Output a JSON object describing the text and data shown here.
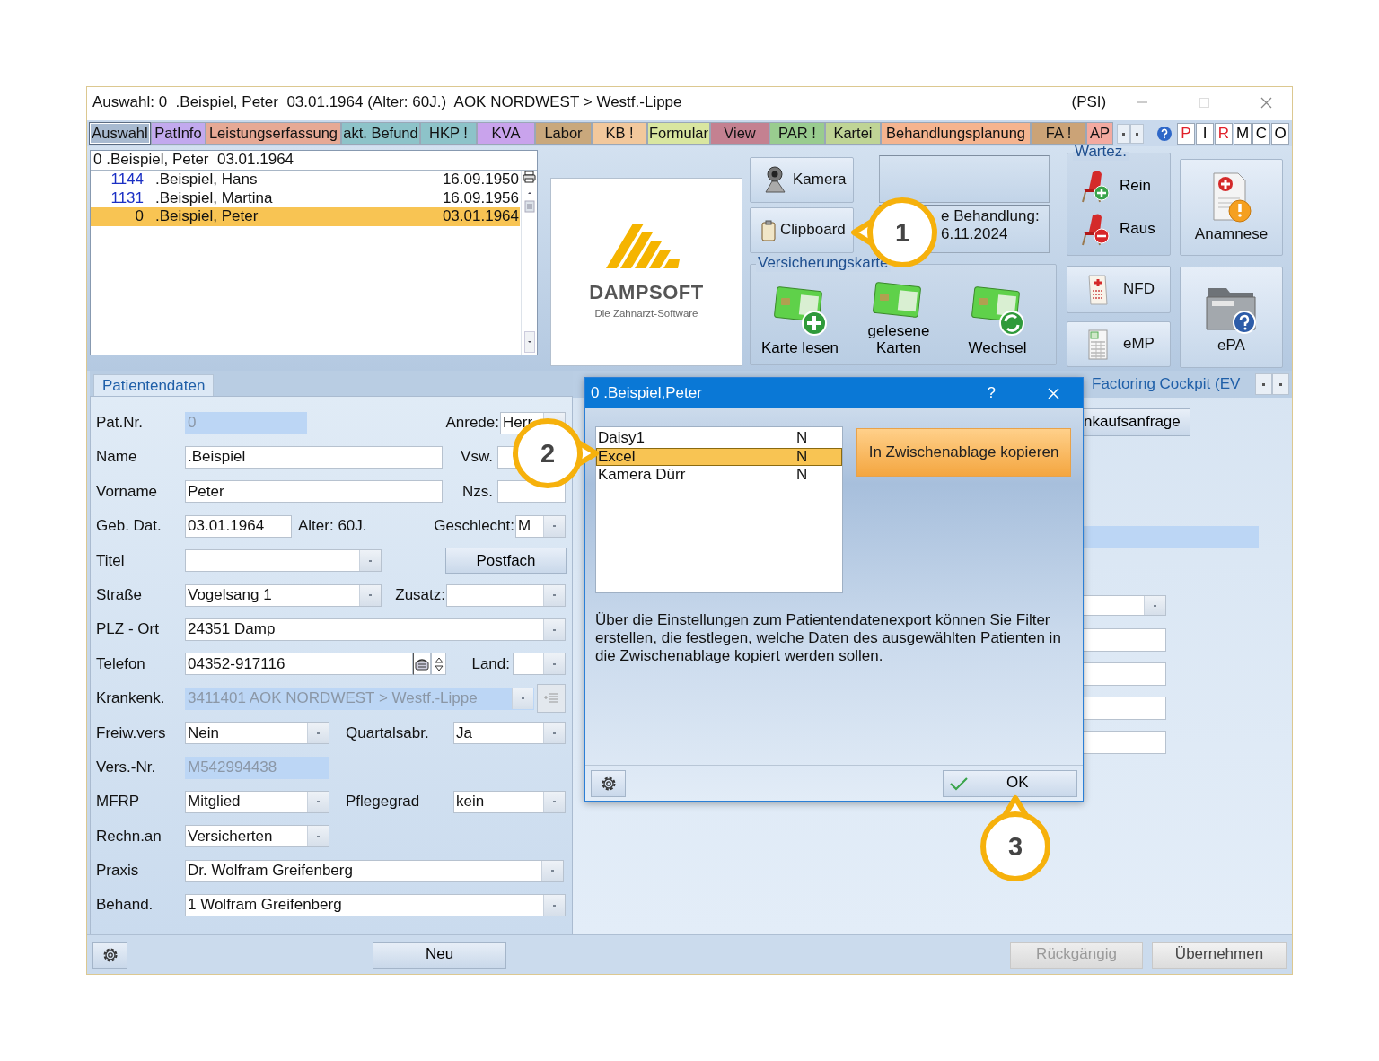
{
  "window": {
    "title": "Auswahl: 0  .Beispiel, Peter  03.01.1964 (Alter: 60J.)  AOK NORDWEST > Westf.-Lippe",
    "tag": "(PSI)"
  },
  "tabs": [
    {
      "label": "Auswahl",
      "color": "#a8bad0",
      "selected": true
    },
    {
      "label": "PatInfo",
      "color": "#c2a9ee",
      "selected": false
    },
    {
      "label": "Leistungserfassung",
      "color": "#e6a995",
      "selected": false
    },
    {
      "label": "akt. Befund",
      "color": "#8dc3c9",
      "selected": false
    },
    {
      "label": "HKP !",
      "color": "#8dc3c9",
      "selected": false
    },
    {
      "label": "KVA",
      "color": "#c9a3ec",
      "selected": false
    },
    {
      "label": "Labor",
      "color": "#c9a87c",
      "selected": false
    },
    {
      "label": "KB !",
      "color": "#f2c89c",
      "selected": false
    },
    {
      "label": "Formular",
      "color": "#d9e6a0",
      "selected": false
    },
    {
      "label": "View",
      "color": "#c48191",
      "selected": false
    },
    {
      "label": "PAR !",
      "color": "#99cc8f",
      "selected": false
    },
    {
      "label": "Kartei",
      "color": "#bfd495",
      "selected": false
    },
    {
      "label": "Behandlungsplanung",
      "color": "#f5b48f",
      "selected": false
    },
    {
      "label": "FA !",
      "color": "#cba377",
      "selected": false
    },
    {
      "label": "AP",
      "color": "#f3aaa0",
      "selected": false
    }
  ],
  "letters": [
    {
      "label": "P",
      "flagged": true
    },
    {
      "label": "I",
      "flagged": false
    },
    {
      "label": "R",
      "flagged": true
    },
    {
      "label": "M",
      "flagged": false
    },
    {
      "label": "C",
      "flagged": false
    },
    {
      "label": "O",
      "flagged": false
    }
  ],
  "patient_search": {
    "value": "0 .Beispiel, Peter  03.01.1964"
  },
  "patients": [
    {
      "number": "1144",
      "name": ".Beispiel, Hans",
      "birth_date": "16.09.1950",
      "selected": false
    },
    {
      "number": "1131",
      "name": ".Beispiel, Martina",
      "birth_date": "16.09.1956",
      "selected": false
    },
    {
      "number": "0",
      "name": ".Beispiel, Peter",
      "birth_date": "03.01.1964",
      "selected": true
    }
  ],
  "logo": {
    "name": "DAMPSOFT",
    "tagline": "Die Zahnarzt-Software"
  },
  "tool_buttons": [
    {
      "kind": "camera",
      "label": "Kamera"
    },
    {
      "kind": "clipboard",
      "label": "Clipboard"
    }
  ],
  "last_treatment": {
    "label": "e Behandlung:",
    "date": "6.11.2024"
  },
  "insurance_card": {
    "title": "Versicherungskarte",
    "buttons": [
      {
        "kind": "read",
        "label": "Karte lesen"
      },
      {
        "kind": "list",
        "label": "gelesene Karten"
      },
      {
        "kind": "swap",
        "label": "Wechsel"
      }
    ]
  },
  "waiting_room": {
    "title": "Wartez.",
    "buttons": [
      {
        "kind": "in",
        "label": "Rein"
      },
      {
        "kind": "out",
        "label": "Raus"
      }
    ]
  },
  "side_buttons": [
    {
      "kind": "anamnese",
      "label": "Anamnese"
    },
    {
      "kind": "nfd",
      "label": "NFD"
    },
    {
      "kind": "emp",
      "label": "eMP"
    },
    {
      "kind": "epa",
      "label": "ePA"
    }
  ],
  "patient_tab": {
    "label": "Patientendaten",
    "selected": true
  },
  "form": {
    "rows": [
      {
        "items": [
          {
            "kind": "label",
            "text": "Pat.Nr."
          },
          {
            "kind": "readonly",
            "value": "0"
          },
          {
            "kind": "label",
            "text": "Anrede:"
          },
          {
            "kind": "select",
            "value": "Herr"
          }
        ]
      },
      {
        "items": [
          {
            "kind": "label",
            "text": "Name"
          },
          {
            "kind": "input",
            "value": ".Beispiel"
          },
          {
            "kind": "label",
            "text": "Vsw."
          },
          {
            "kind": "input"
          }
        ]
      },
      {
        "items": [
          {
            "kind": "label",
            "text": "Vorname"
          },
          {
            "kind": "input",
            "value": "Peter"
          },
          {
            "kind": "label",
            "text": "Nzs."
          },
          {
            "kind": "input"
          }
        ]
      },
      {
        "items": [
          {
            "kind": "label",
            "text": "Geb. Dat."
          },
          {
            "kind": "input",
            "value": "03.01.1964"
          },
          {
            "kind": "label",
            "text": "Alter: 60J."
          },
          {
            "kind": "label",
            "text": "Geschlecht:"
          },
          {
            "kind": "select",
            "value": "M"
          }
        ]
      },
      {
        "items": [
          {
            "kind": "label",
            "text": "Titel"
          },
          {
            "kind": "select"
          },
          {
            "kind": "button",
            "text": "Postfach"
          }
        ]
      },
      {
        "items": [
          {
            "kind": "label",
            "text": "Straße"
          },
          {
            "kind": "select",
            "value": "Vogelsang 1"
          },
          {
            "kind": "label",
            "text": "Zusatz:"
          },
          {
            "kind": "select"
          }
        ]
      },
      {
        "items": [
          {
            "kind": "label",
            "text": "PLZ - Ort"
          },
          {
            "kind": "select",
            "value": "24351 Damp"
          }
        ]
      },
      {
        "items": [
          {
            "kind": "label",
            "text": "Telefon"
          },
          {
            "kind": "phone",
            "value": "04352-917116"
          },
          {
            "kind": "label",
            "text": "Land:"
          },
          {
            "kind": "select"
          }
        ]
      },
      {
        "items": [
          {
            "kind": "label",
            "text": "Krankenk."
          },
          {
            "kind": "readonly_select",
            "value": "3411401 AOK NORDWEST > Westf.-Lippe"
          },
          {
            "kind": "list_button"
          }
        ]
      },
      {
        "items": [
          {
            "kind": "label",
            "text": "Freiw.vers"
          },
          {
            "kind": "select",
            "value": "Nein"
          },
          {
            "kind": "label",
            "text": "Quartalsabr."
          },
          {
            "kind": "select",
            "value": "Ja"
          }
        ]
      },
      {
        "items": [
          {
            "kind": "label",
            "text": "Vers.-Nr."
          },
          {
            "kind": "readonly",
            "value": "M542994438"
          }
        ]
      },
      {
        "items": [
          {
            "kind": "label",
            "text": "MFRP"
          },
          {
            "kind": "select",
            "value": "Mitglied"
          },
          {
            "kind": "label",
            "text": "Pflegegrad"
          },
          {
            "kind": "select",
            "value": "kein"
          }
        ]
      },
      {
        "items": [
          {
            "kind": "label",
            "text": "Rechn.an"
          },
          {
            "kind": "select",
            "value": "Versicherten"
          }
        ]
      },
      {
        "items": [
          {
            "kind": "label",
            "text": "Praxis"
          },
          {
            "kind": "select",
            "value": "Dr. Wolfram Greifenberg"
          }
        ]
      },
      {
        "items": [
          {
            "kind": "label",
            "text": "Behand."
          },
          {
            "kind": "select",
            "value": "1 Wolfram Greifenberg"
          }
        ]
      }
    ]
  },
  "right_panel": {
    "tab": "Factoring Cockpit (EV",
    "button": "nkaufsanfrage"
  },
  "footer": {
    "new": "Neu",
    "undo": {
      "label": "Rückgängig",
      "disabled": true
    },
    "apply": {
      "label": "Übernehmen",
      "disabled": false
    }
  },
  "dialog": {
    "title": "0 .Beispiel,Peter",
    "help": "?",
    "exports": [
      {
        "name": "Daisy1",
        "flag": "N",
        "selected": false
      },
      {
        "name": "Excel",
        "flag": "N",
        "selected": true
      },
      {
        "name": "Kamera Dürr",
        "flag": "N",
        "selected": false
      }
    ],
    "copy_button": "In Zwischenablage kopieren",
    "info": "Über die Einstellungen zum Patientendatenexport können Sie Filter erstellen, die festlegen, welche Daten des ausgewählten Patienten in die Zwischenablage kopiert werden sollen.",
    "ok": "OK"
  },
  "callouts": [
    {
      "number": "1"
    },
    {
      "number": "2"
    },
    {
      "number": "3"
    }
  ]
}
